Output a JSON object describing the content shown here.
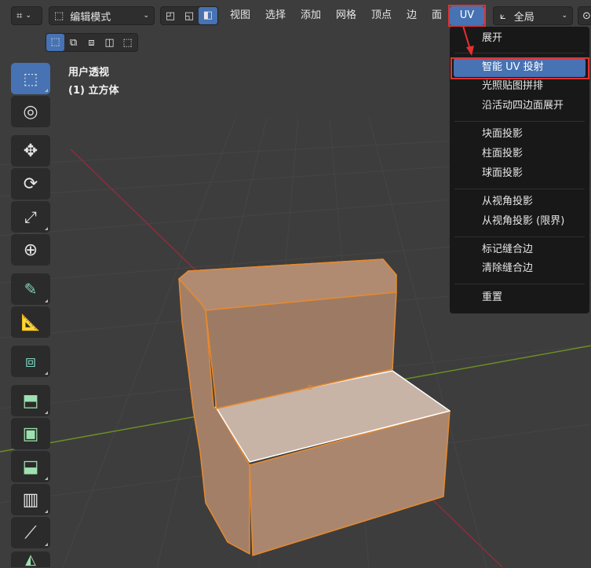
{
  "header": {
    "mode_label": "编辑模式",
    "menus": [
      "视图",
      "选择",
      "添加",
      "网格",
      "顶点",
      "边",
      "面",
      "UV"
    ],
    "transform_orientation": "全局"
  },
  "viewport": {
    "view_name": "用户透视",
    "object_name": "(1) 立方体"
  },
  "uv_menu": {
    "items": [
      {
        "label": "展开"
      },
      {
        "label": "智能 UV 投射",
        "highlighted": true
      },
      {
        "label": "光照贴图拼排"
      },
      {
        "label": "沿活动四边面展开"
      },
      {
        "label": "块面投影"
      },
      {
        "label": "柱面投影"
      },
      {
        "label": "球面投影"
      },
      {
        "label": "从视角投影"
      },
      {
        "label": "从视角投影 (限界)"
      },
      {
        "label": "标记缝合边"
      },
      {
        "label": "清除缝合边"
      },
      {
        "label": "重置"
      }
    ]
  },
  "colors": {
    "accent": "#4772b3",
    "annotation_red": "#e33131",
    "object_fill": "#a37f68",
    "object_edge": "#e68a2e",
    "x_axis": "#8b2e3c",
    "y_axis": "#6b8e23"
  },
  "toolbar": {
    "tools": [
      "select-box-icon",
      "cursor-icon",
      "move-icon",
      "rotate-icon",
      "scale-icon",
      "transform-icon",
      "annotate-icon",
      "measure-icon",
      "add-cube-icon",
      "extrude-icon",
      "inset-icon",
      "bevel-icon",
      "loop-cut-icon",
      "knife-icon",
      "poly-build-icon"
    ]
  }
}
